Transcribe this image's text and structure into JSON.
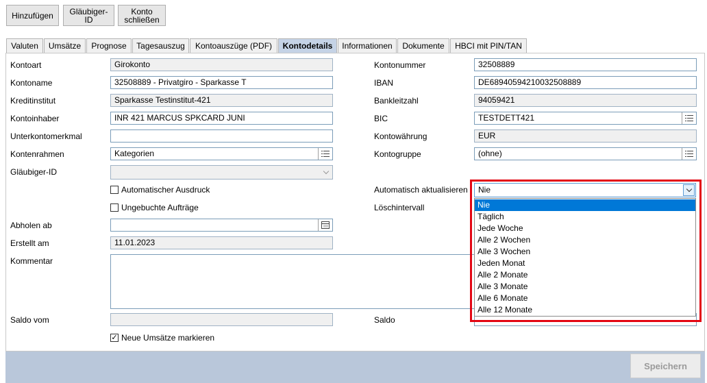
{
  "toolbar": {
    "add_label": "Hinzufügen",
    "creditor_id_label_1": "Gläubiger-",
    "creditor_id_label_2": "ID",
    "close_account_label_1": "Konto",
    "close_account_label_2": "schließen"
  },
  "tabs": [
    {
      "label": "Valuten"
    },
    {
      "label": "Umsätze"
    },
    {
      "label": "Prognose"
    },
    {
      "label": "Tagesauszug"
    },
    {
      "label": "Kontoauszüge (PDF)"
    },
    {
      "label": "Kontodetails"
    },
    {
      "label": "Informationen"
    },
    {
      "label": "Dokumente"
    },
    {
      "label": "HBCI mit PIN/TAN"
    }
  ],
  "form": {
    "account_type": {
      "label": "Kontoart",
      "value": "Girokonto"
    },
    "account_name": {
      "label": "Kontoname",
      "value": "32508889 - Privatgiro - Sparkasse T"
    },
    "institute": {
      "label": "Kreditinstitut",
      "value": "Sparkasse Testinstitut-421"
    },
    "holder": {
      "label": "Kontoinhaber",
      "value": "INR 421 MARCUS SPKCARD JUNI"
    },
    "sub_account": {
      "label": "Unterkontomerkmal",
      "value": ""
    },
    "chart_of_accounts": {
      "label": "Kontenrahmen",
      "value": "Kategorien"
    },
    "creditor_id": {
      "label": "Gläubiger-ID",
      "value": ""
    },
    "auto_print": {
      "label": "Automatischer Ausdruck",
      "checked": false
    },
    "unbooked_orders": {
      "label": "Ungebuchte Aufträge",
      "checked": false
    },
    "fetch_from": {
      "label": "Abholen ab",
      "value": ""
    },
    "created_on": {
      "label": "Erstellt am",
      "value": "11.01.2023"
    },
    "comment": {
      "label": "Kommentar",
      "value": ""
    },
    "balance_date": {
      "label": "Saldo vom",
      "value": ""
    },
    "mark_new": {
      "label": "Neue Umsätze markieren",
      "checked": true,
      "check_glyph": "✓"
    },
    "account_number": {
      "label": "Kontonummer",
      "value": "32508889"
    },
    "iban": {
      "label": "IBAN",
      "value": "DE68940594210032508889"
    },
    "bank_code": {
      "label": "Bankleitzahl",
      "value": "94059421"
    },
    "bic": {
      "label": "BIC",
      "value": "TESTDETT421"
    },
    "currency": {
      "label": "Kontowährung",
      "value": "EUR"
    },
    "account_group": {
      "label": "Kontogruppe",
      "value": "(ohne)"
    },
    "auto_update": {
      "label": "Automatisch aktualisieren",
      "value": "Nie"
    },
    "delete_interval": {
      "label": "Löschintervall"
    },
    "balance": {
      "label": "Saldo",
      "value": ""
    }
  },
  "dropdown": {
    "options": [
      {
        "label": "Nie",
        "selected": true
      },
      {
        "label": "Täglich"
      },
      {
        "label": "Jede Woche"
      },
      {
        "label": "Alle 2 Wochen"
      },
      {
        "label": "Alle 3 Wochen"
      },
      {
        "label": "Jeden Monat"
      },
      {
        "label": "Alle 2 Monate"
      },
      {
        "label": "Alle 3 Monate"
      },
      {
        "label": "Alle 6 Monate"
      },
      {
        "label": "Alle 12 Monate"
      }
    ]
  },
  "footer": {
    "save_label": "Speichern"
  },
  "colors": {
    "highlight": "#e30613",
    "active_tab": "#c5d3e6",
    "selection": "#0078d7"
  }
}
